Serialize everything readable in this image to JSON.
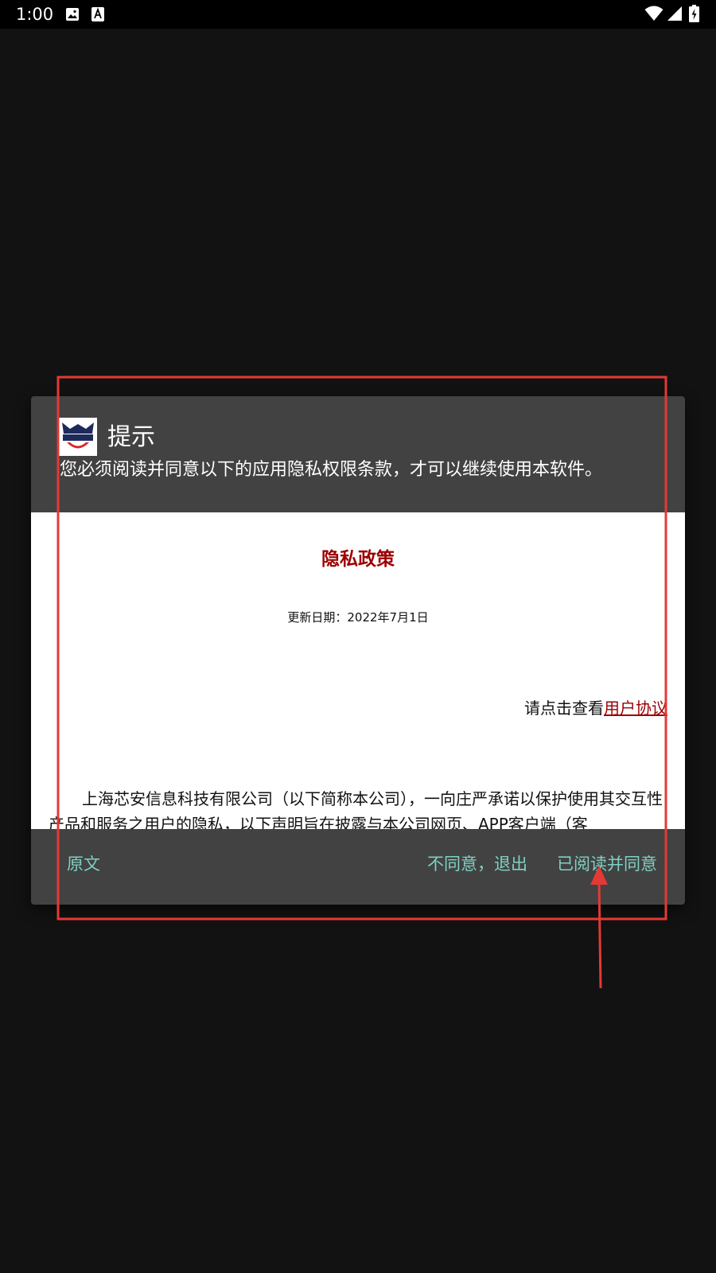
{
  "status_bar": {
    "time": "1:00",
    "icons": [
      "image-icon",
      "a-icon",
      "wifi-icon",
      "signal-icon",
      "battery-icon"
    ]
  },
  "dialog": {
    "title": "提示",
    "message": "您必须阅读并同意以下的应用隐私权限条款，才可以继续使用本软件。",
    "logo": "app-logo-icon"
  },
  "policy": {
    "title": "隐私政策",
    "update_date": "更新日期：2022年7月1日",
    "view_prefix": "请点击查看",
    "agreement_link": "用户协议",
    "body": "上海芯安信息科技有限公司（以下简称本公司），一向庄严承诺以保护使用其交互性产品和服务之用户的隐私，以下声明旨在披露与本公司网页、APP客户端（客"
  },
  "actions": {
    "original": "原文",
    "disagree": "不同意，退出",
    "agree": "已阅读并同意"
  },
  "colors": {
    "accent": "#7fd0c4",
    "policy_red": "#9b0000",
    "annotation": "#e53935",
    "dialog_bg": "#424242",
    "screen_bg": "#121212"
  }
}
